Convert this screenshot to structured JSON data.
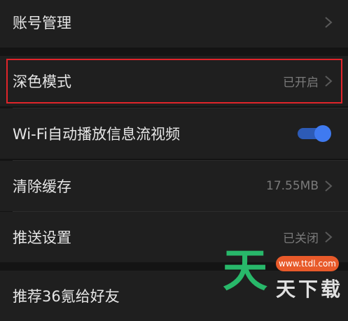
{
  "settings": {
    "account": {
      "label": "账号管理"
    },
    "dark_mode": {
      "label": "深色模式",
      "value": "已开启"
    },
    "wifi_autoplay": {
      "label": "Wi-Fi自动播放信息流视频",
      "enabled": true
    },
    "clear_cache": {
      "label": "清除缓存",
      "value": "17.55MB"
    },
    "push": {
      "label": "推送设置",
      "value": "已关闭"
    },
    "recommend": {
      "label": "推荐36氪给好友"
    }
  },
  "colors": {
    "highlight_border": "#e0242a",
    "toggle_on": "#3f7af0"
  },
  "watermark": {
    "big": "天",
    "site": "www.ttdl.com",
    "small": "天下载"
  }
}
